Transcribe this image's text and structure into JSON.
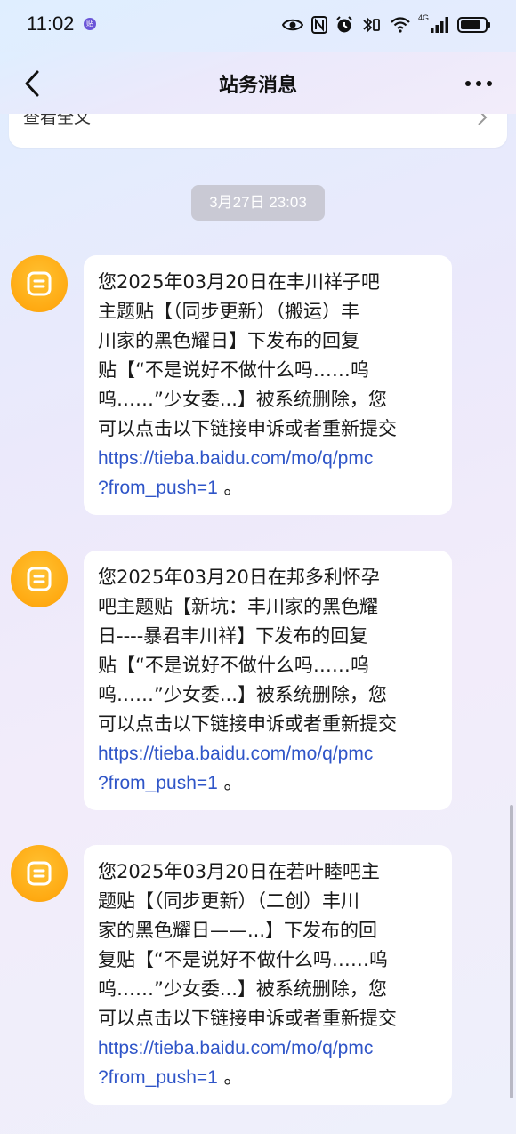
{
  "status_bar": {
    "time": "11:02",
    "badge": "贴",
    "network": "4G"
  },
  "nav": {
    "title": "站务消息",
    "back_icon": "chevron-left-icon",
    "more_icon": "more-horizontal-icon"
  },
  "previous_card": {
    "link_text": "查看全文"
  },
  "date_separator": "3月27日 23:03",
  "messages": [
    {
      "text": "您2025年03月20日在丰川祥子吧\n主题贴【（同步更新）（搬运）丰\n川家的黑色耀日】下发布的回复\n贴【“不是说好不做什么吗……呜\n呜……”少女委...】被系统删除，您\n可以点击以下链接申诉或者重新提交\n",
      "link": "https://tieba.baidu.com/mo/q/pmc\n?from_push=1",
      "suffix": " 。"
    },
    {
      "text": "您2025年03月20日在邦多利怀孕\n吧主题贴【新坑：丰川家的黑色耀\n日----暴君丰川祥】下发布的回复\n贴【“不是说好不做什么吗……呜\n呜……”少女委...】被系统删除，您\n可以点击以下链接申诉或者重新提交\n",
      "link": "https://tieba.baidu.com/mo/q/pmc\n?from_push=1",
      "suffix": " 。"
    },
    {
      "text": "您2025年03月20日在若叶睦吧主\n题贴【（同步更新）（二创）丰川\n家的黑色耀日——...】下发布的回\n复贴【“不是说好不做什么吗……呜\n呜……”少女委...】被系统删除，您\n可以点击以下链接申诉或者重新提交\n",
      "link": "https://tieba.baidu.com/mo/q/pmc\n?from_push=1",
      "suffix": " 。"
    }
  ],
  "colors": {
    "avatar": "#ffaa12",
    "link": "#2f55c8",
    "date_chip": "#c9c9d4"
  }
}
